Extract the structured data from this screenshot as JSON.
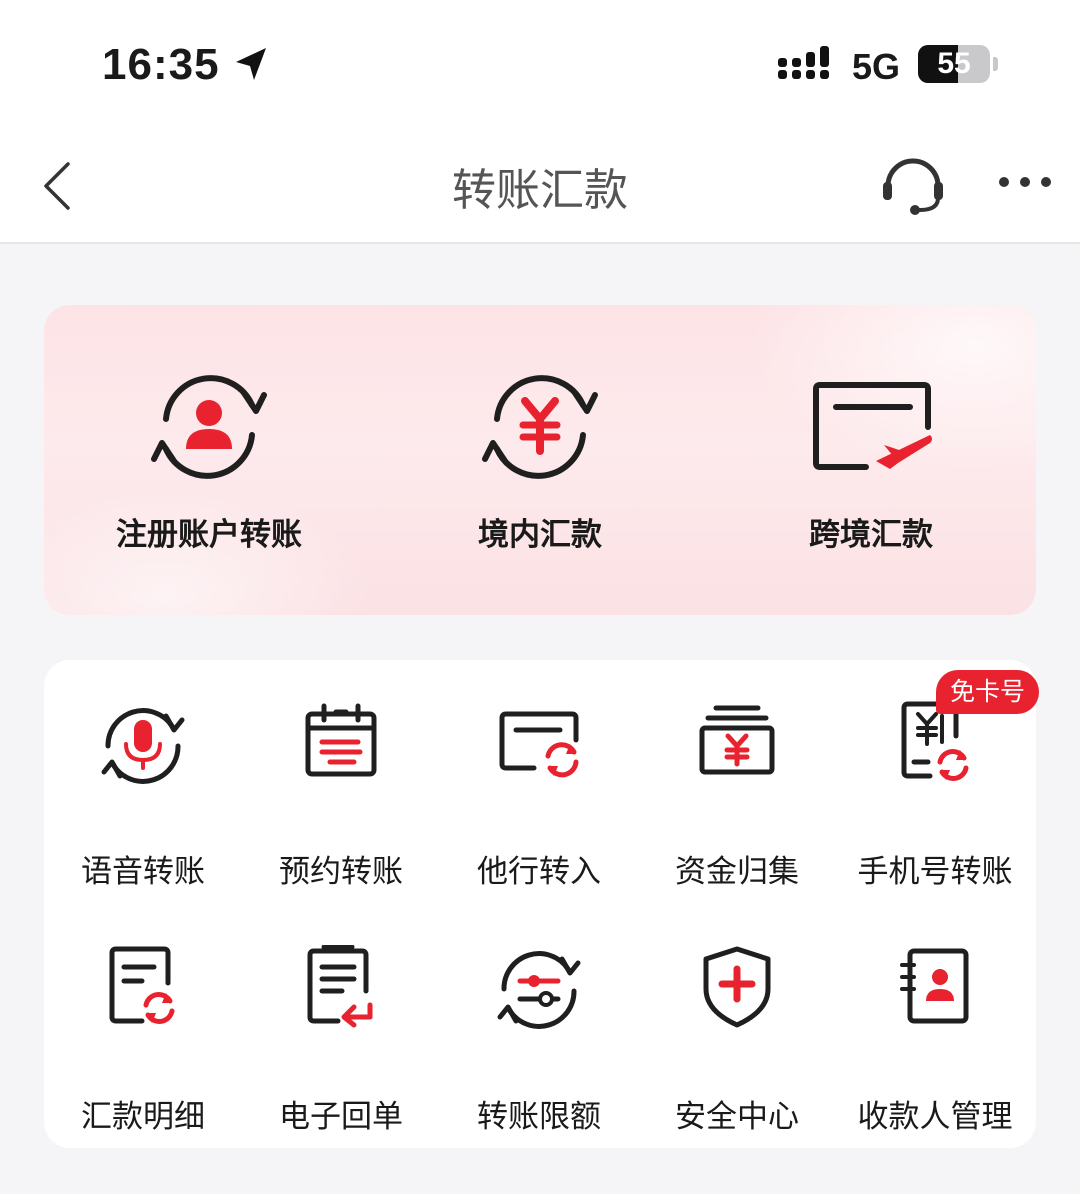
{
  "status_bar": {
    "time": "16:35",
    "network": "5G",
    "battery_level": "55",
    "battery_fraction": 0.55
  },
  "nav": {
    "title": "转账汇款",
    "icons": [
      "chevron-left-icon",
      "headset-icon",
      "more-icon"
    ]
  },
  "top_services": [
    {
      "label": "注册账户转账",
      "icon": "account-transfer-icon"
    },
    {
      "label": "境内汇款",
      "icon": "yuan-cycle-icon"
    },
    {
      "label": "跨境汇款",
      "icon": "card-plane-icon"
    }
  ],
  "grid_services": [
    {
      "label": "语音转账",
      "icon": "microphone-cycle-icon"
    },
    {
      "label": "预约转账",
      "icon": "calendar-icon"
    },
    {
      "label": "他行转入",
      "icon": "card-refresh-icon"
    },
    {
      "label": "资金归集",
      "icon": "money-box-icon"
    },
    {
      "label": "手机号转账",
      "icon": "phone-yuan-icon",
      "badge": "免卡号"
    },
    {
      "label": "汇款明细",
      "icon": "document-refresh-icon"
    },
    {
      "label": "电子回单",
      "icon": "receipt-return-icon"
    },
    {
      "label": "转账限额",
      "icon": "slider-cycle-icon"
    },
    {
      "label": "安全中心",
      "icon": "shield-plus-icon"
    },
    {
      "label": "收款人管理",
      "icon": "contact-book-icon"
    }
  ],
  "colors": {
    "accent": "#e8222f",
    "icon_stroke": "#2b2b2b",
    "top_card_bg": "#fde3e6"
  }
}
